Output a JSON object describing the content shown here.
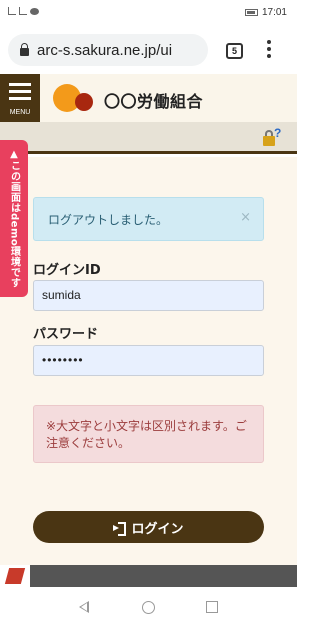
{
  "status_bar": {
    "time": "17:01",
    "signal_icon": "signal-icon",
    "chat_icon": "chat-icon",
    "battery_icon": "battery-icon"
  },
  "browser": {
    "url": "arc-s.sakura.ne.jp/ui",
    "tab_count": "5",
    "lock_icon": "lock-icon",
    "menu_icon": "kebab-menu-icon"
  },
  "header": {
    "menu_label": "MENU",
    "site_name": "〇〇労働組合",
    "help_icon": "lock-help-icon"
  },
  "demo_banner": "▲この画面はdemo環境です",
  "alert_info": {
    "message": "ログアウトしました。",
    "close": "×"
  },
  "form": {
    "login_id_label": "ログインID",
    "login_id_value": "sumida",
    "password_label": "パスワード",
    "password_value": "••••••••"
  },
  "alert_warning": {
    "message": "※大文字と小文字は区別されます。ご注意ください。"
  },
  "login_button": {
    "label": "ログイン",
    "icon": "sign-in-icon"
  },
  "colors": {
    "brand_brown": "#4a3513",
    "demo_pink": "#e8405e",
    "info_bg": "#d2ebf4",
    "warn_bg": "#f4dcdd",
    "logo_orange": "#f39a1a",
    "logo_red": "#a8270f"
  }
}
